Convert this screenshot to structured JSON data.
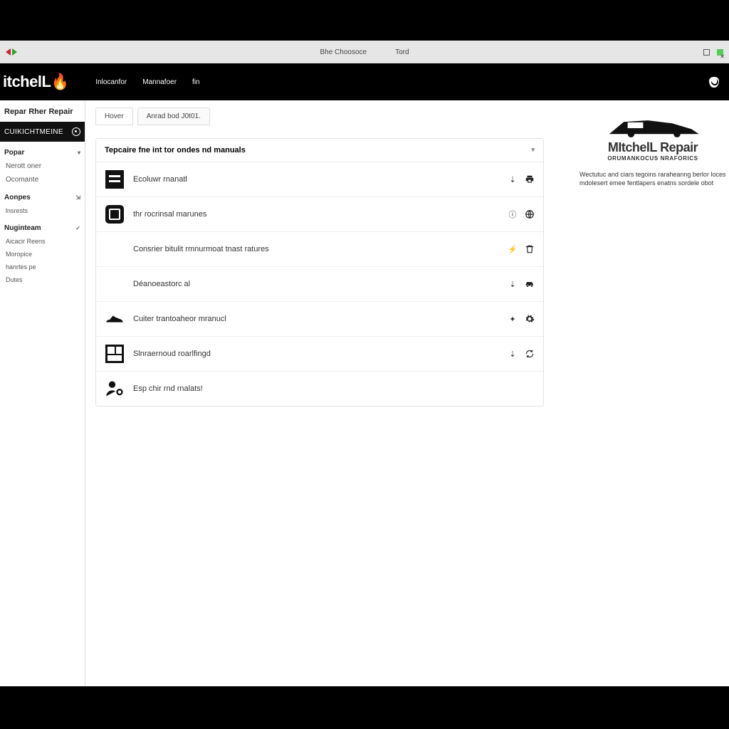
{
  "chrome": {
    "center1": "Bhe Choosoce",
    "center2": "Tord"
  },
  "header": {
    "logo_text": "itchelL",
    "nav": [
      "Inlocanfor",
      "Mannafoer",
      "fin"
    ]
  },
  "sidebar": {
    "title": "Repar Rher Repair",
    "active": "CUIKICHTMEINE",
    "sections": [
      {
        "head": "Popar",
        "items": [
          "Nerott oner",
          "Ocomante"
        ]
      },
      {
        "head": "Aonpes",
        "items": [
          "lnsrests"
        ]
      },
      {
        "head": "Nuginteam",
        "items": [
          "Aicacir Reens",
          "Moropice",
          "hanrtes pe",
          "Dutes"
        ]
      }
    ]
  },
  "tabs": [
    "Hover",
    "Anrad bod J0t01."
  ],
  "panel": {
    "title": "Tepcaire fne int tor ondes nd manuals",
    "rows": [
      "Ecoluwr rnanatl",
      "thr rocrinsal marunes",
      "Consrier bitulit rmnurmoat tnast ratures",
      "Déanoeastorc al",
      "Cuiter trantoaheor mranucl",
      "Slnraernoud roarlfingd",
      "Esp chir rnd rnalats!"
    ]
  },
  "info": {
    "brand1": "MItchelL Repair",
    "brand2": "ORUMANKOCUS NRAFORICS",
    "copy": "Wectutuc and ciars tegoins raraheanng berlor loces mdolesert emee fentlapers enatns sordele obot"
  }
}
